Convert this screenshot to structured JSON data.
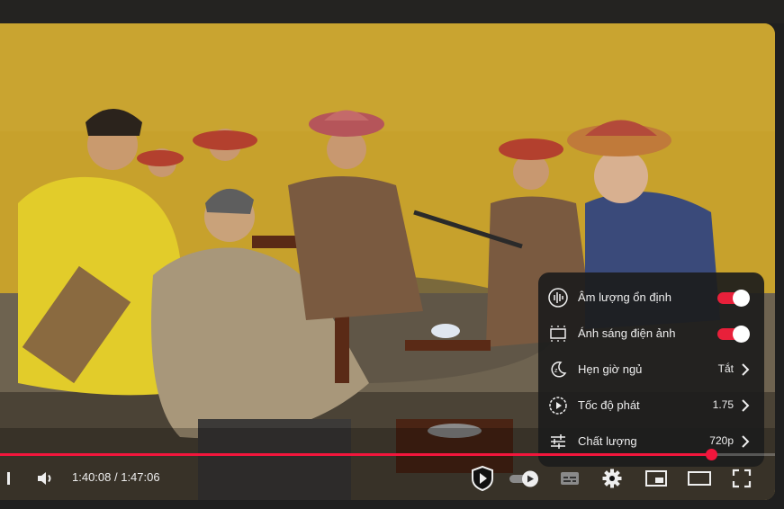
{
  "settings_menu": {
    "items": [
      {
        "label": "Âm lượng ổn định",
        "icon": "stable-volume-icon",
        "toggle": true
      },
      {
        "label": "Ánh sáng điện ảnh",
        "icon": "ambient-mode-icon",
        "toggle": true
      },
      {
        "label": "Hẹn giờ ngủ",
        "icon": "sleep-timer-icon",
        "value": "Tắt"
      },
      {
        "label": "Tốc độ phát",
        "icon": "playback-speed-icon",
        "value": "1.75"
      },
      {
        "label": "Chất lượng",
        "icon": "quality-icon",
        "value": "720p"
      }
    ]
  },
  "player": {
    "current_time": "1:40:08",
    "duration": "1:47:06",
    "time_display": "1:40:08 / 1:47:06",
    "progress_fraction": 0.917,
    "accent_color": "#f2163c"
  },
  "controls": {
    "icons": [
      "next-icon",
      "volume-icon",
      "sponsor-shield-icon",
      "autoplay-toggle-icon",
      "subtitles-icon",
      "settings-gear-icon",
      "miniplayer-icon",
      "theater-mode-icon",
      "fullscreen-icon"
    ]
  }
}
